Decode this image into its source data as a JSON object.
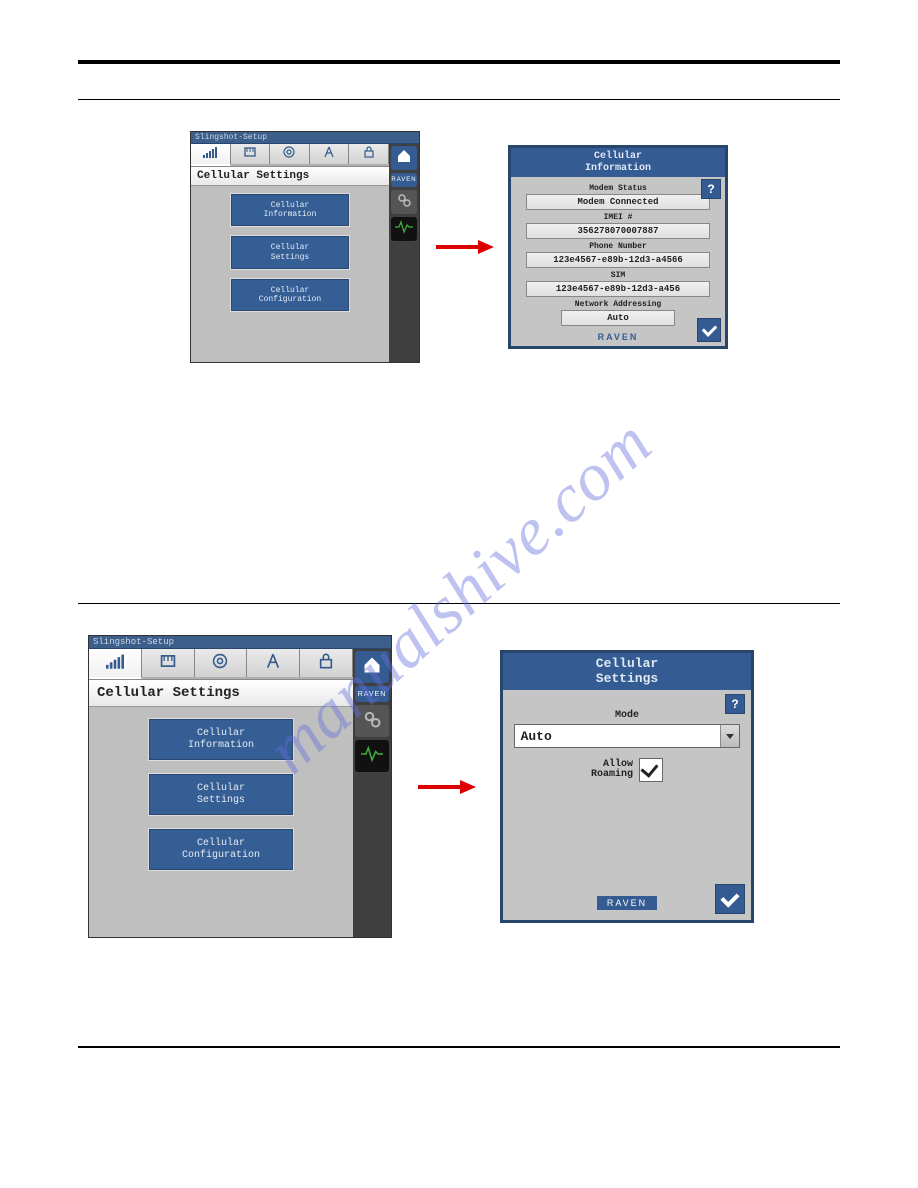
{
  "watermark": "manualshive.com",
  "device_titlebar": "Slingshot-Setup",
  "device_heading": "Cellular Settings",
  "menu_buttons": {
    "info": "Cellular\nInformation",
    "settings": "Cellular\nSettings",
    "config": "Cellular\nConfiguration"
  },
  "sidebar_raven": "RAVEN",
  "info_panel": {
    "title_l1": "Cellular",
    "title_l2": "Information",
    "fields": {
      "modem_status_label": "Modem Status",
      "modem_status_value": "Modem Connected",
      "imei_label": "IMEI #",
      "imei_value": "356278070007887",
      "phone_label": "Phone Number",
      "phone_value": "123e4567-e89b-12d3-a4566",
      "sim_label": "SIM",
      "sim_value": "123e4567-e89b-12d3-a456",
      "net_label": "Network Addressing",
      "net_value": "Auto"
    },
    "raven": "RAVEN"
  },
  "settings_panel": {
    "title_l1": "Cellular",
    "title_l2": "Settings",
    "mode_label": "Mode",
    "mode_value": "Auto",
    "roaming_label_l1": "Allow",
    "roaming_label_l2": "Roaming",
    "raven": "RAVEN"
  }
}
